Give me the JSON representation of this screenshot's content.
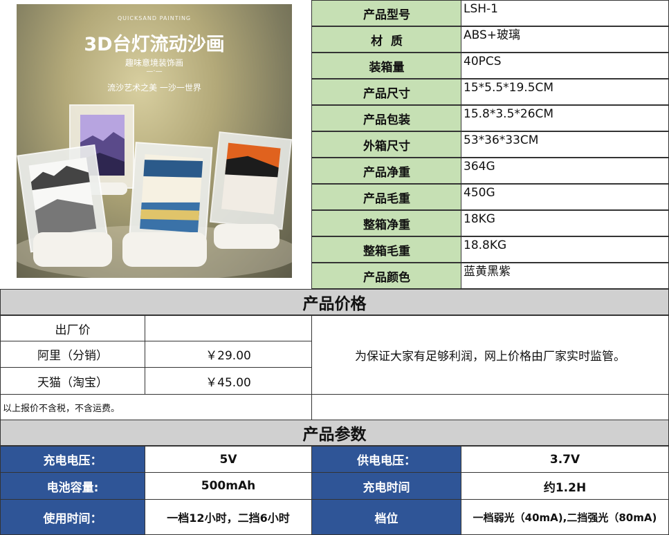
{
  "photo": {
    "brand": "QUICKSAND PAINTING",
    "headline": "3D台灯流动沙画",
    "subtitle": "趣味意境装饰画",
    "tagline": "流沙艺术之美 一沙一世界"
  },
  "specs": [
    {
      "label": "产品型号",
      "value": "LSH-1"
    },
    {
      "label": "材  质",
      "value": "ABS+玻璃"
    },
    {
      "label": "装箱量",
      "value": "40PCS"
    },
    {
      "label": "产品尺寸",
      "value": "15*5.5*19.5CM"
    },
    {
      "label": "产品包装",
      "value": "15.8*3.5*26CM"
    },
    {
      "label": "外箱尺寸",
      "value": "53*36*33CM"
    },
    {
      "label": "产品净重",
      "value": "364G"
    },
    {
      "label": "产品毛重",
      "value": "450G"
    },
    {
      "label": "整箱净重",
      "value": "18KG"
    },
    {
      "label": "整箱毛重",
      "value": "18.8KG"
    },
    {
      "label": "产品颜色",
      "value": "蓝黄黑紫"
    }
  ],
  "price_section": {
    "title": "产品价格",
    "rows": [
      {
        "label": "出厂价",
        "value": ""
      },
      {
        "label": "阿里（分销）",
        "value": "￥29.00"
      },
      {
        "label": "天猫（淘宝）",
        "value": "￥45.00"
      }
    ],
    "note": "为保证大家有足够利润，网上价格由厂家实时监管。",
    "footnote": "以上报价不含税，不含运费。"
  },
  "param_section": {
    "title": "产品参数",
    "rows": [
      {
        "l1": "充电电压：",
        "v1": "5V",
        "l2": "供电电压：",
        "v2": "3.7V"
      },
      {
        "l1": "电池容量:",
        "v1": "500mAh",
        "l2": "充电时间",
        "v2": "约1.2H"
      },
      {
        "l1": "使用时间：",
        "v1": "一档12小时，二挡6小时",
        "l2": "档位",
        "v2": "一档弱光（40mA),二挡强光（80mA)"
      }
    ]
  },
  "colors": {
    "spec_label_bg": "#c6e0b4",
    "param_label_bg": "#2f5597",
    "section_bg": "#d0d0d0"
  }
}
